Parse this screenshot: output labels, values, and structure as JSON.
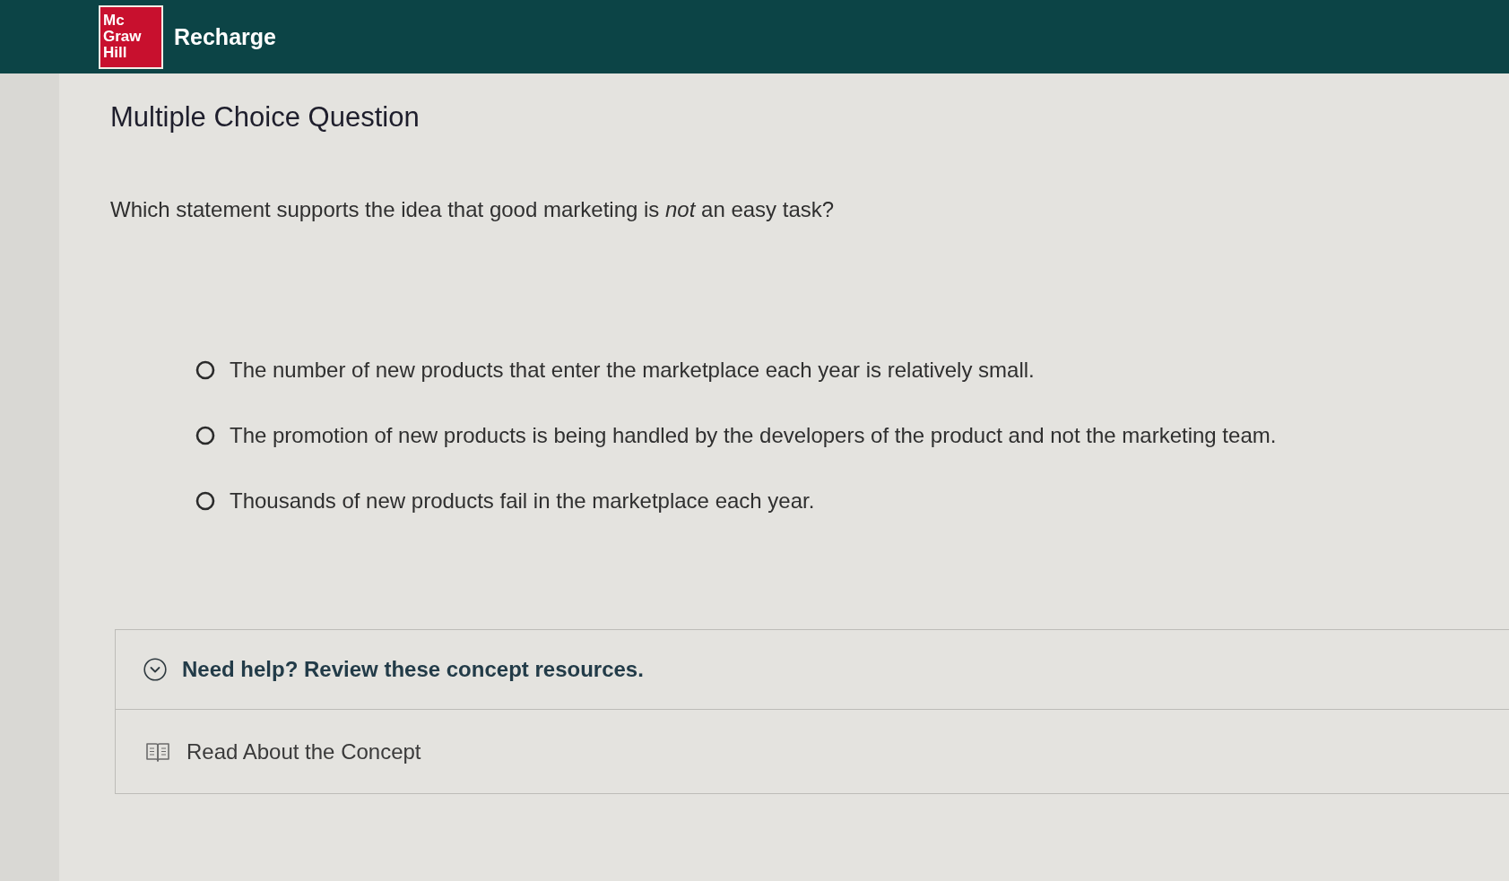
{
  "header": {
    "logo_lines": [
      "Mc",
      "Graw",
      "Hill"
    ],
    "title": "Recharge"
  },
  "question": {
    "heading": "Multiple Choice Question",
    "prompt": "Which statement supports the idea that good marketing is *not* an easy task?",
    "options": [
      {
        "text": "The number of new products that enter the marketplace each year is relatively small.",
        "selected": false
      },
      {
        "text": "The promotion of new products is being handled by the developers of the product and not the marketing team.",
        "selected": false
      },
      {
        "text": "Thousands of new products fail in the marketplace each year.",
        "selected": false
      }
    ]
  },
  "help": {
    "title": "Need help? Review these concept resources.",
    "expanded": true,
    "resources": [
      "Read About the Concept"
    ]
  }
}
